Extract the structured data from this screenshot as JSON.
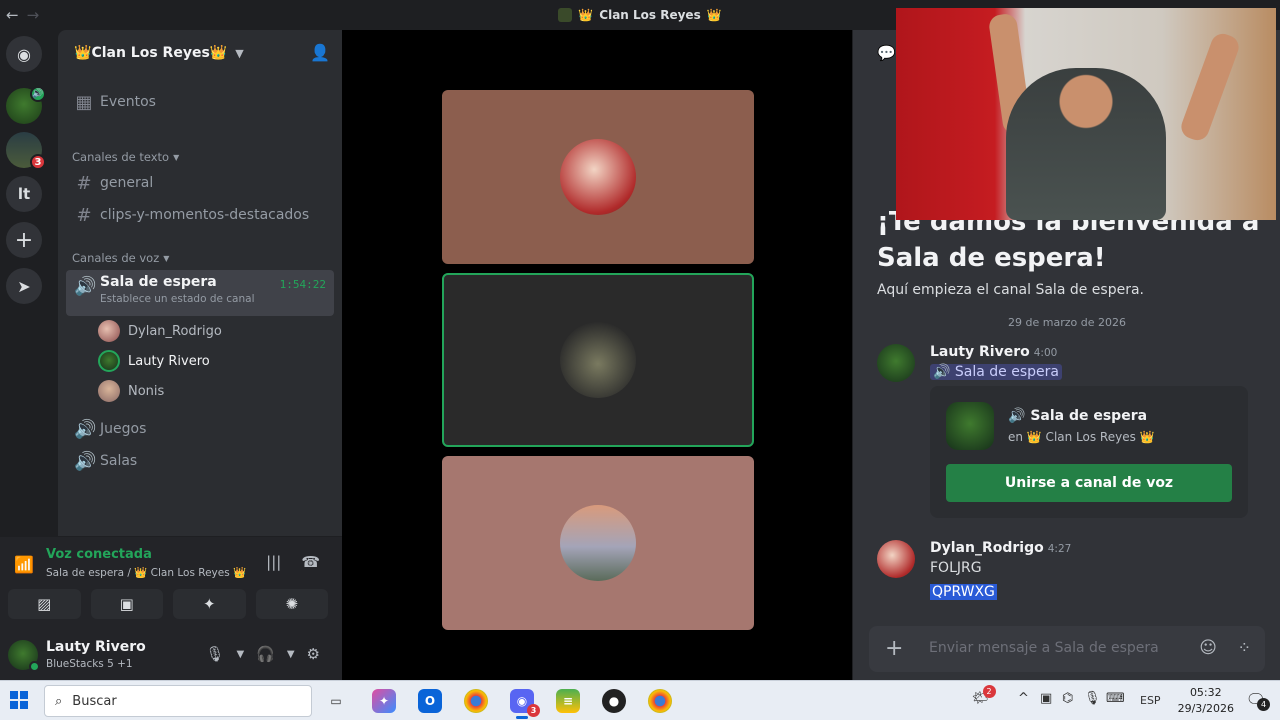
{
  "window": {
    "title": "Clan Los Reyes",
    "back": "←",
    "forward": "→"
  },
  "rail": {
    "home_glyph": "◉",
    "lt": "lt",
    "add": "+",
    "explore": "➤",
    "srv2_badge": "3"
  },
  "server": {
    "name": "Clan Los Reyes",
    "crown": "👑"
  },
  "sidebar": {
    "events": "Eventos",
    "text_category": "Canales de texto",
    "text_channels": [
      "general",
      "clips-y-momentos-destacados"
    ],
    "voice_category": "Canales de voz",
    "active_channel": {
      "name": "Sala de espera",
      "status": "Establece un estado de canal",
      "timer": "1:54:22"
    },
    "voice_users": [
      "Dylan_Rodrigo",
      "Lauty Rivero",
      "Nonis"
    ],
    "other_voice_channels": [
      "Juegos",
      "Salas"
    ]
  },
  "voice_panel": {
    "title": "Voz conectada",
    "subtitle": "Sala de espera / 👑 Clan Los Reyes 👑"
  },
  "user_panel": {
    "name": "Lauty Rivero",
    "status": "BlueStacks 5 +1"
  },
  "chat": {
    "welcome_title": "¡Te damos la bienvenida a Sala de espera!",
    "welcome_desc": "Aquí empieza el canal Sala de espera.",
    "date": "29 de marzo de 2026",
    "messages": [
      {
        "author": "Lauty Rivero",
        "time": "4:00",
        "mention": "🔊 Sala de espera",
        "embed": {
          "title": "Sala de espera",
          "sub": "en 👑 Clan Los Reyes 👑",
          "button": "Unirse a canal de voz"
        }
      },
      {
        "author": "Dylan_Rodrigo",
        "time": "4:27",
        "lines": [
          "FOLJRG",
          "QPRWXG"
        ]
      }
    ],
    "input_placeholder": "Enviar mensaje a Sala de espera"
  },
  "taskbar": {
    "search": "Buscar",
    "lang": "ESP",
    "time": "05:32",
    "date": "29/3/2026",
    "notif_count": "4",
    "app_badge": "3",
    "tray_badge": "2"
  }
}
